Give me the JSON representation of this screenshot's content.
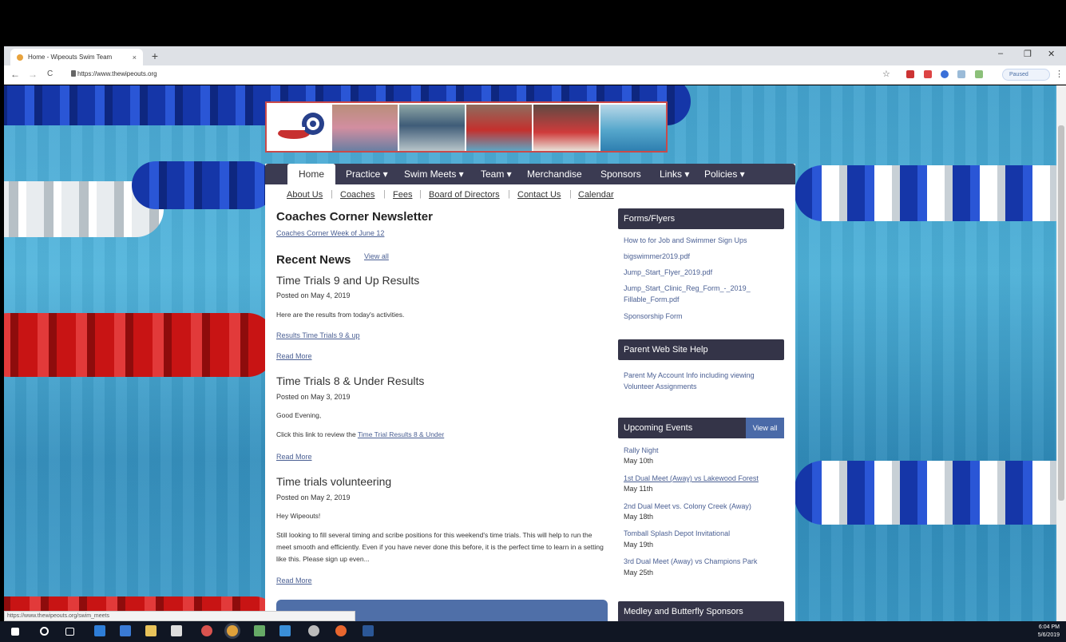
{
  "browser": {
    "tab_title": "Home - Wipeouts Swim Team",
    "tab_close": "×",
    "new_tab": "+",
    "url": "https://www.thewipeouts.org",
    "paused_label": "Paused",
    "minimize": "–",
    "restore": "❐",
    "close": "✕",
    "back": "←",
    "forward": "→",
    "reload": "C",
    "bookmark_star": "☆",
    "menu": "⋮",
    "status_url": "https://www.thewipeouts.org/swim_meets"
  },
  "nav": {
    "items": [
      {
        "label": "Home"
      },
      {
        "label": "Practice ▾"
      },
      {
        "label": "Swim Meets ▾"
      },
      {
        "label": "Team ▾"
      },
      {
        "label": "Merchandise"
      },
      {
        "label": "Sponsors"
      },
      {
        "label": "Links ▾"
      },
      {
        "label": "Policies ▾"
      }
    ]
  },
  "subnav": {
    "items": [
      {
        "label": "About Us"
      },
      {
        "label": "Coaches"
      },
      {
        "label": "Fees"
      },
      {
        "label": "Board of Directors"
      },
      {
        "label": "Contact Us"
      },
      {
        "label": "Calendar"
      }
    ]
  },
  "main": {
    "newsletter_title": "Coaches Corner Newsletter",
    "newsletter_link": "Coaches Corner Week of June 12",
    "news_title": "Recent News",
    "news_view_all": "View all",
    "articles": [
      {
        "title": "Time Trials 9 and Up Results",
        "posted": "Posted on May 4, 2019",
        "body": "Here are the results from today's activities.",
        "link": "Results Time Trials 9 & up",
        "read_more": "Read More"
      },
      {
        "title": "Time Trials 8 & Under Results",
        "posted": "Posted on May 3, 2019",
        "body": "Good Evening,",
        "body2_prefix": "Click this link to review the ",
        "body2_link": "Time Trial Results 8 & Under",
        "read_more": "Read More"
      },
      {
        "title": "Time trials volunteering",
        "posted": "Posted on May 2, 2019",
        "body": "Hey Wipeouts!",
        "body2": "Still looking to fill several timing and scribe positions for this weekend's time trials. This will help to run the meet smooth and efficiently. Even if you have never done this before, it is the perfect time to learn in a setting like this. Please sign up even...",
        "read_more": "Read More"
      }
    ]
  },
  "sidebar": {
    "forms_title": "Forms/Flyers",
    "forms": [
      "How to for Job and Swimmer Sign Ups",
      "bigswimmer2019.pdf",
      "Jump_Start_Flyer_2019.pdf",
      "Jump_Start_Clinic_Reg_Form_-_2019_Fillable_Form.pdf",
      "Sponsorship Form"
    ],
    "help_title": "Parent Web Site Help",
    "help_link": "Parent My Account Info including viewing Volunteer Assignments",
    "events_title": "Upcoming Events",
    "events_view_all": "View all",
    "events": [
      {
        "name": "Rally Night",
        "date": "May 10th"
      },
      {
        "name": "1st Dual Meet (Away) vs Lakewood Forest",
        "date": "May 11th"
      },
      {
        "name": "2nd Dual Meet vs. Colony Creek (Away)",
        "date": "May 18th"
      },
      {
        "name": "Tomball Splash Depot Invitational",
        "date": "May 19th"
      },
      {
        "name": "3rd Dual Meet (Away) vs Champions Park",
        "date": "May 25th"
      }
    ],
    "sponsors_title": "Medley and Butterfly Sponsors"
  },
  "taskbar": {
    "time": "6:04 PM",
    "date": "5/6/2019"
  }
}
